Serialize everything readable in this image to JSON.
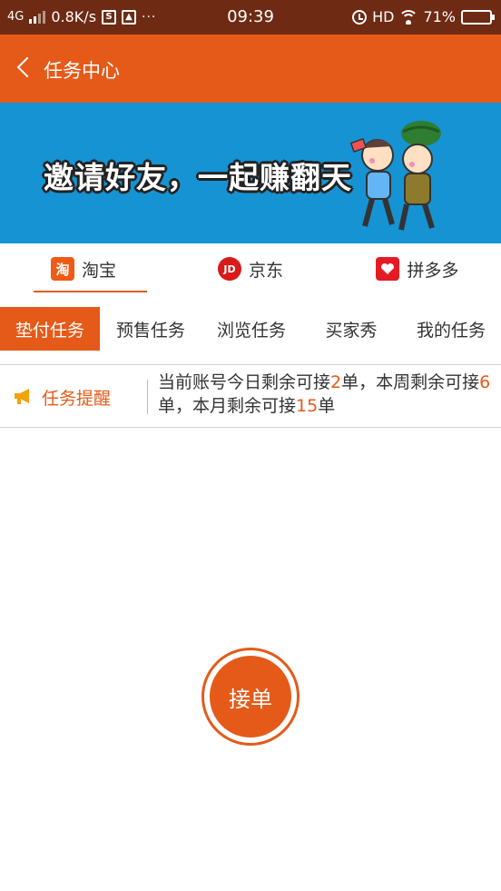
{
  "status_bar": {
    "network": "4G",
    "speed": "0.8K/s",
    "icon_s": "S",
    "dots": "···",
    "time": "09:39",
    "hd": "HD",
    "battery_percent": "71%",
    "battery_level": 0.71
  },
  "header": {
    "title": "任务中心"
  },
  "banner": {
    "text": "邀请好友，一起赚翻天"
  },
  "platform_tabs": [
    {
      "label": "淘宝",
      "icon_char": "淘",
      "active": true
    },
    {
      "label": "京东",
      "icon_char": "JD",
      "active": false
    },
    {
      "label": "拼多多",
      "icon_char": "",
      "active": false
    }
  ],
  "task_tabs": [
    {
      "label": "垫付任务",
      "active": true
    },
    {
      "label": "预售任务",
      "active": false
    },
    {
      "label": "浏览任务",
      "active": false
    },
    {
      "label": "买家秀",
      "active": false
    },
    {
      "label": "我的任务",
      "active": false
    }
  ],
  "notice": {
    "label": "任务提醒",
    "part1": "当前账号今日剩余可接",
    "today": "2",
    "part2": "单，本周剩余可接",
    "week": "6",
    "part3": "单，本月剩余可接",
    "month": "15",
    "part4": "单"
  },
  "accept_button": {
    "label": "接单"
  },
  "colors": {
    "accent": "#e55a19",
    "status_bar": "#6e2a12",
    "banner_bg": "#1693d3"
  }
}
